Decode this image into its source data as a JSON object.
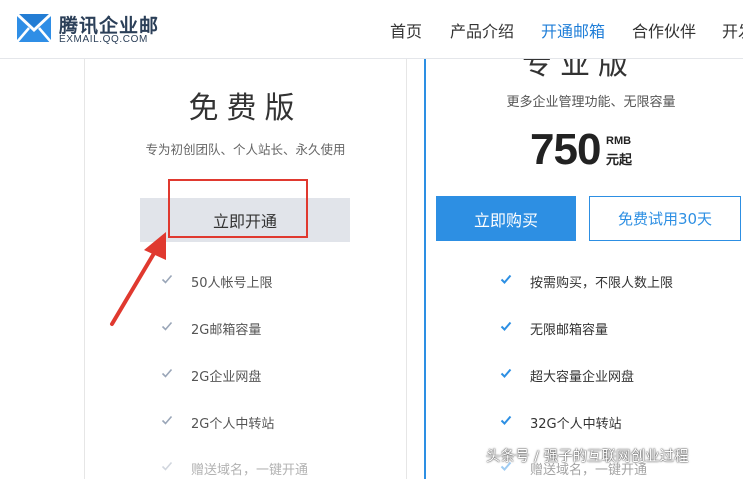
{
  "header": {
    "logo_name": "腾讯企业邮",
    "logo_url": "EXMAIL.QQ.COM",
    "nav": [
      {
        "label": "首页",
        "active": false
      },
      {
        "label": "产品介绍",
        "active": false
      },
      {
        "label": "开通邮箱",
        "active": true
      },
      {
        "label": "合作伙伴",
        "active": false
      },
      {
        "label": "开发",
        "active": false
      }
    ]
  },
  "free_plan": {
    "title": "免费版",
    "subtitle": "专为初创团队、个人站长、永久使用",
    "open_button": "立即开通",
    "features": [
      "50人帐号上限",
      "2G邮箱容量",
      "2G企业网盘",
      "2G个人中转站",
      "赠送域名，一键开通"
    ]
  },
  "pro_plan": {
    "title_partial": "专业版",
    "subtitle": "更多企业管理功能、无限容量",
    "price": "750",
    "currency": "RMB",
    "price_unit": "元起",
    "buy_button": "立即购买",
    "trial_button": "免费试用30天",
    "features": [
      "按需购买，不限人数上限",
      "无限邮箱容量",
      "超大容量企业网盘",
      "32G个人中转站",
      "赠送域名，一键开通"
    ]
  },
  "watermark": "头条号 / 强子的互联网创业过程",
  "colors": {
    "accent": "#2d8fe3",
    "nav_active": "#1f7ed8",
    "annotation_red": "#e0392f",
    "free_check": "#9aa6b8",
    "pro_check": "#2d8fe3"
  }
}
